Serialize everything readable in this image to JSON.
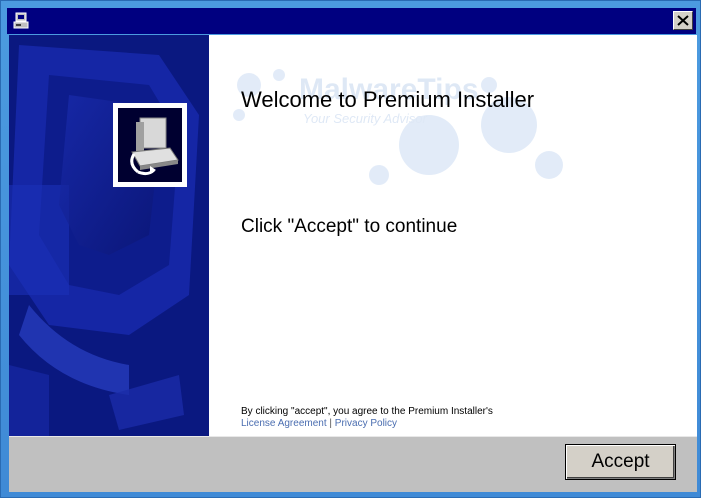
{
  "window": {
    "title": "",
    "app_icon": "installer-app-icon",
    "close_icon": "close-x-icon"
  },
  "side_panel": {
    "logo_icon": "computer-install-icon"
  },
  "content": {
    "heading": "Welcome to Premium Installer",
    "instruction": "Click \"Accept\" to continue",
    "agreement_text": "By clicking \"accept\", you agree to the Premium Installer's",
    "license_link": "License Agreement",
    "separator": "|",
    "privacy_link": "Privacy Policy"
  },
  "watermark": {
    "brand": "MalwareTips",
    "tagline": "Your Security Advisor"
  },
  "buttons": {
    "accept_label": "Accept"
  },
  "colors": {
    "titlebar": "#000080",
    "side_panel": "#0a1880",
    "link": "#4a6db0"
  }
}
